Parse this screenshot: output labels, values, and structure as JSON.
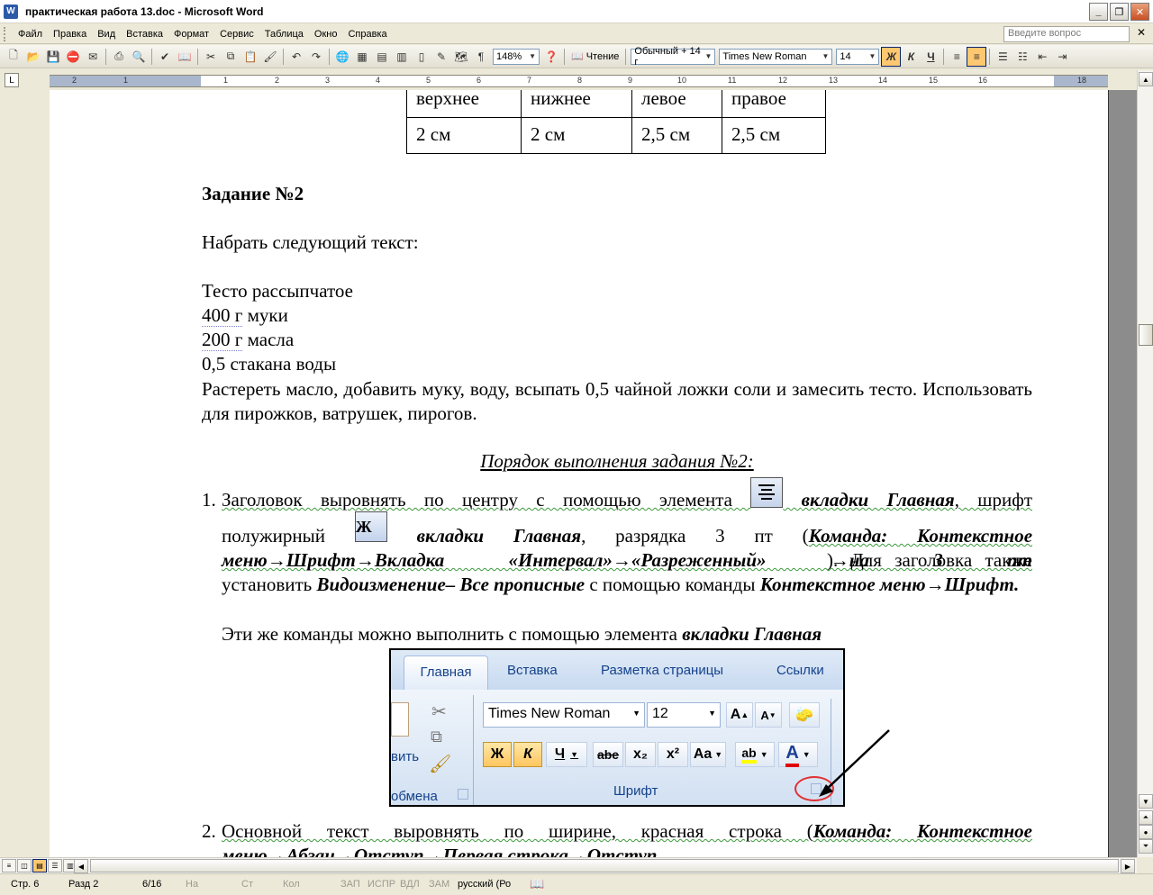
{
  "window": {
    "title": "практическая работа 13.doc - Microsoft Word",
    "app_icon": "W"
  },
  "menu": {
    "items": [
      "Файл",
      "Правка",
      "Вид",
      "Вставка",
      "Формат",
      "Сервис",
      "Таблица",
      "Окно",
      "Справка"
    ],
    "ask_placeholder": "Введите вопрос"
  },
  "toolbar": {
    "zoom": "148%",
    "reading_label": "Чтение",
    "style": "Обычный + 14 г",
    "font": "Times New Roman",
    "size": "14",
    "bold": "Ж",
    "italic": "К",
    "underline": "Ч"
  },
  "ruler": {
    "marks": [
      "2",
      "1",
      "1",
      "2",
      "3",
      "4",
      "5",
      "6",
      "7",
      "8",
      "9",
      "10",
      "11",
      "12",
      "13",
      "14",
      "15",
      "16",
      "18"
    ]
  },
  "document": {
    "table": {
      "header": [
        "верхнее",
        "нижнее",
        "левое",
        "правое"
      ],
      "row": [
        "2 см",
        "2 см",
        "2,5 см",
        "2,5 см"
      ]
    },
    "task_heading": "Задание №2",
    "instruction": "Набрать следующий текст:",
    "recipe_title": "Тесто рассыпчатое",
    "recipe_lines": [
      {
        "qty": "400 г",
        "rest": " муки"
      },
      {
        "qty": "200 г",
        "rest": " масла"
      }
    ],
    "recipe_water": "0,5 стакана воды",
    "recipe_body": "Растереть масло, добавить муку, воду, всыпать 0,5 чайной ложки соли и замесить тесто. Использовать для пирожков, ватрушек, пирогов.",
    "procedure_heading": "Порядок выполнения задания №2:",
    "step1": {
      "num": "1.",
      "p1": "Заголовок выровнять по центру с помощью элемента",
      "p1b": "вкладки Главная",
      "p1c": ", шрифт",
      "p2": "полужирный",
      "bold_icon": "Ж",
      "p2b": "вкладки Главная",
      "p2c": ", разрядка 3 пт (",
      "p2d": "Команда: Контекстное меню→Шрифт→Вкладка «Интервал»→«Разреженный» →на 3 пт",
      "p2e": "). Для заголовка также установить",
      "p2f": "Видоизменение– Все прописные",
      "p2g": "с помощью команды",
      "p2h": "Контекстное меню→Шрифт.",
      "p3": "Эти же команды можно выполнить с помощью элемента",
      "p3b": "вкладки Главная"
    },
    "ribbon": {
      "tabs": [
        "Главная",
        "Вставка",
        "Разметка страницы",
        "Ссылки"
      ],
      "font": "Times New Roman",
      "size": "12",
      "clipboard_partial": "вить",
      "clipboard_label": "обмена",
      "font_group_label": "Шрифт",
      "bold": "Ж",
      "italic": "К",
      "underline": "Ч",
      "strike": "abe",
      "subscript": "x₂",
      "superscript": "x²",
      "case": "Aa"
    },
    "step2": {
      "num": "2.",
      "p1": "Основной текст выровнять по ширине, красная строка (",
      "p1b": "Команда: Контекстное",
      "p2": "меню→Абзац→Отступ→Первая строка→Отступ"
    }
  },
  "status": {
    "page": "Стр. 6",
    "section": "Разд 2",
    "pages": "6/16",
    "at": "На",
    "line": "Ст",
    "col": "Кол",
    "rec": "ЗАП",
    "trk": "ИСПР",
    "ext": "ВДЛ",
    "ovr": "ЗАМ",
    "lang": "русский (Ро"
  }
}
